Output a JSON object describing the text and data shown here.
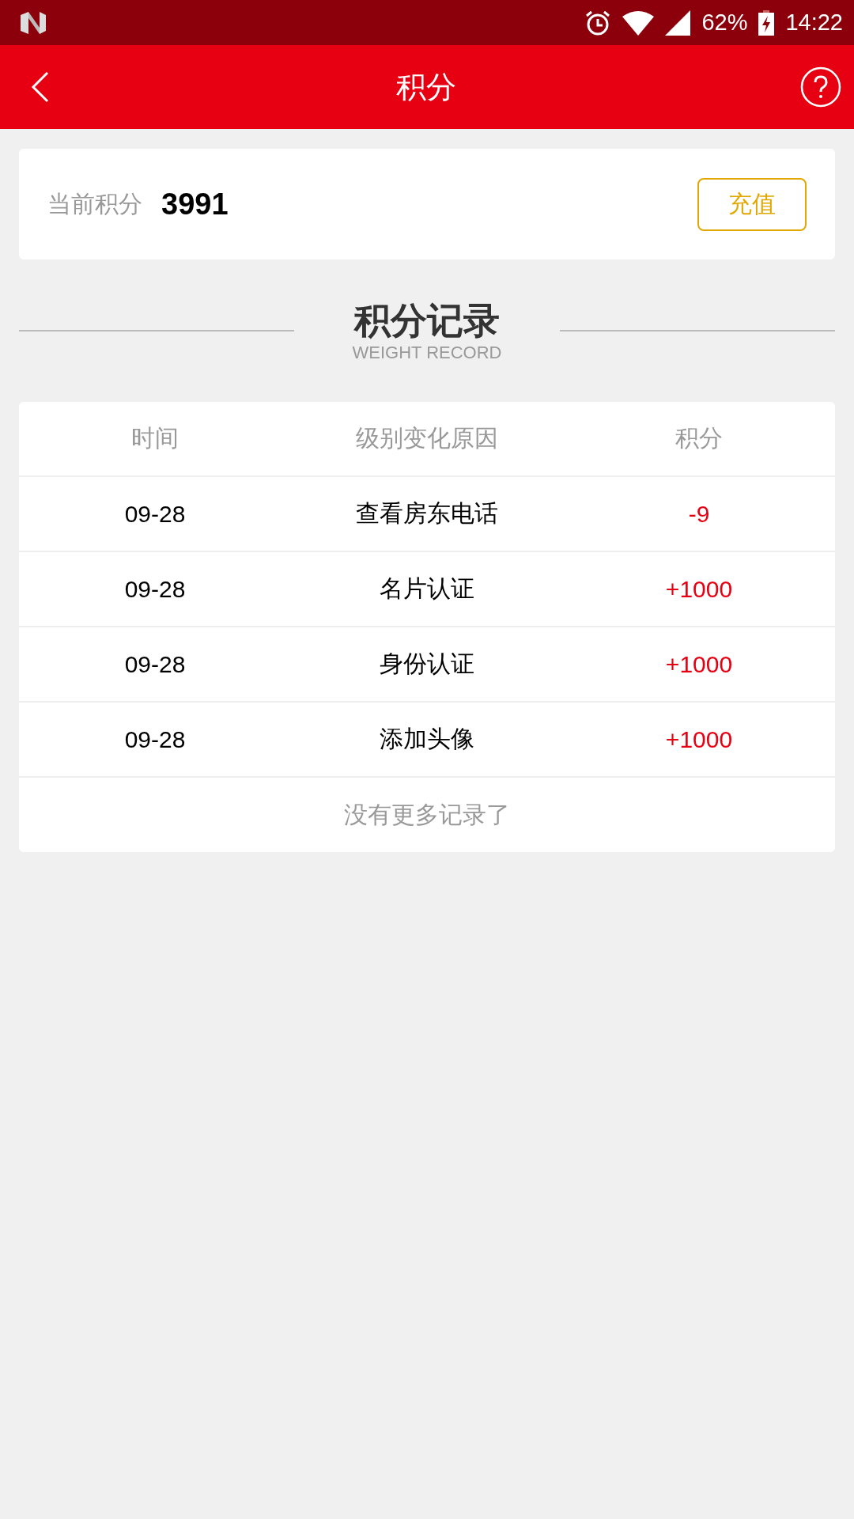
{
  "status_bar": {
    "battery": "62%",
    "time": "14:22"
  },
  "header": {
    "title": "积分"
  },
  "points_card": {
    "label": "当前积分",
    "value": "3991",
    "recharge_button": "充值"
  },
  "section": {
    "title": "积分记录",
    "subtitle": "WEIGHT RECORD"
  },
  "table": {
    "columns": [
      "时间",
      "级别变化原因",
      "积分"
    ],
    "rows": [
      {
        "time": "09-28",
        "reason": "查看房东电话",
        "points": "-9"
      },
      {
        "time": "09-28",
        "reason": "名片认证",
        "points": "+1000"
      },
      {
        "time": "09-28",
        "reason": "身份认证",
        "points": "+1000"
      },
      {
        "time": "09-28",
        "reason": "添加头像",
        "points": "+1000"
      }
    ],
    "footer": "没有更多记录了"
  }
}
